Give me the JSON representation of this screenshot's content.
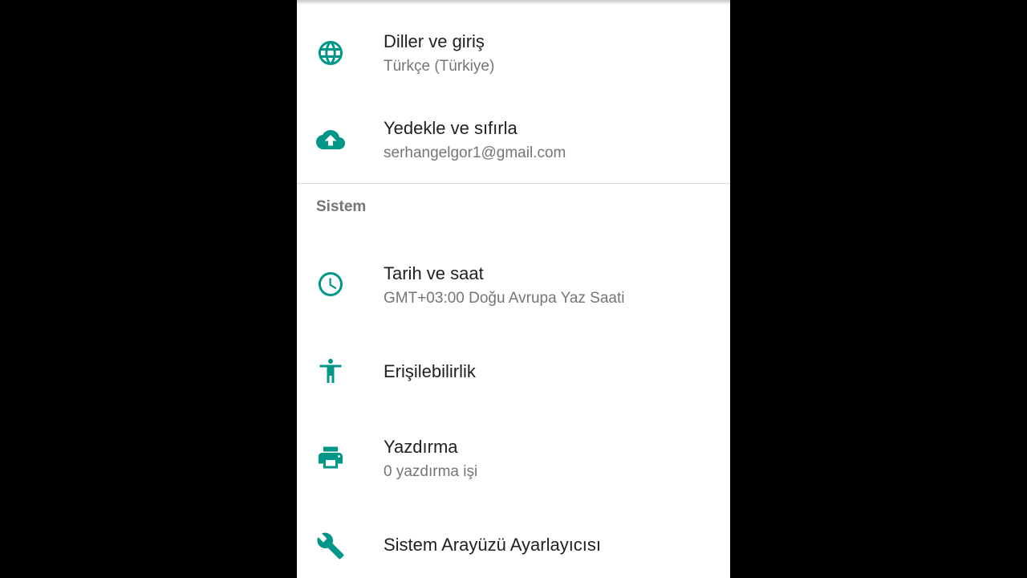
{
  "colors": {
    "accent": "#009688",
    "title": "#212121",
    "summary": "#757575",
    "background": "#ffffff",
    "letterbox": "#000000"
  },
  "settings": {
    "items_top": [
      {
        "title": "Diller ve giriş",
        "summary": "Türkçe (Türkiye)",
        "icon": "globe-icon"
      },
      {
        "title": "Yedekle ve sıfırla",
        "summary": "serhangelgor1@gmail.com",
        "icon": "cloud-upload-icon"
      }
    ],
    "category_system": "Sistem",
    "items_system": [
      {
        "title": "Tarih ve saat",
        "summary": "GMT+03:00 Doğu Avrupa Yaz Saati",
        "icon": "clock-icon"
      },
      {
        "title": "Erişilebilirlik",
        "icon": "accessibility-icon"
      },
      {
        "title": "Yazdırma",
        "summary": "0 yazdırma işi",
        "icon": "printer-icon"
      },
      {
        "title": "Sistem Arayüzü Ayarlayıcısı",
        "icon": "wrench-icon"
      }
    ]
  }
}
